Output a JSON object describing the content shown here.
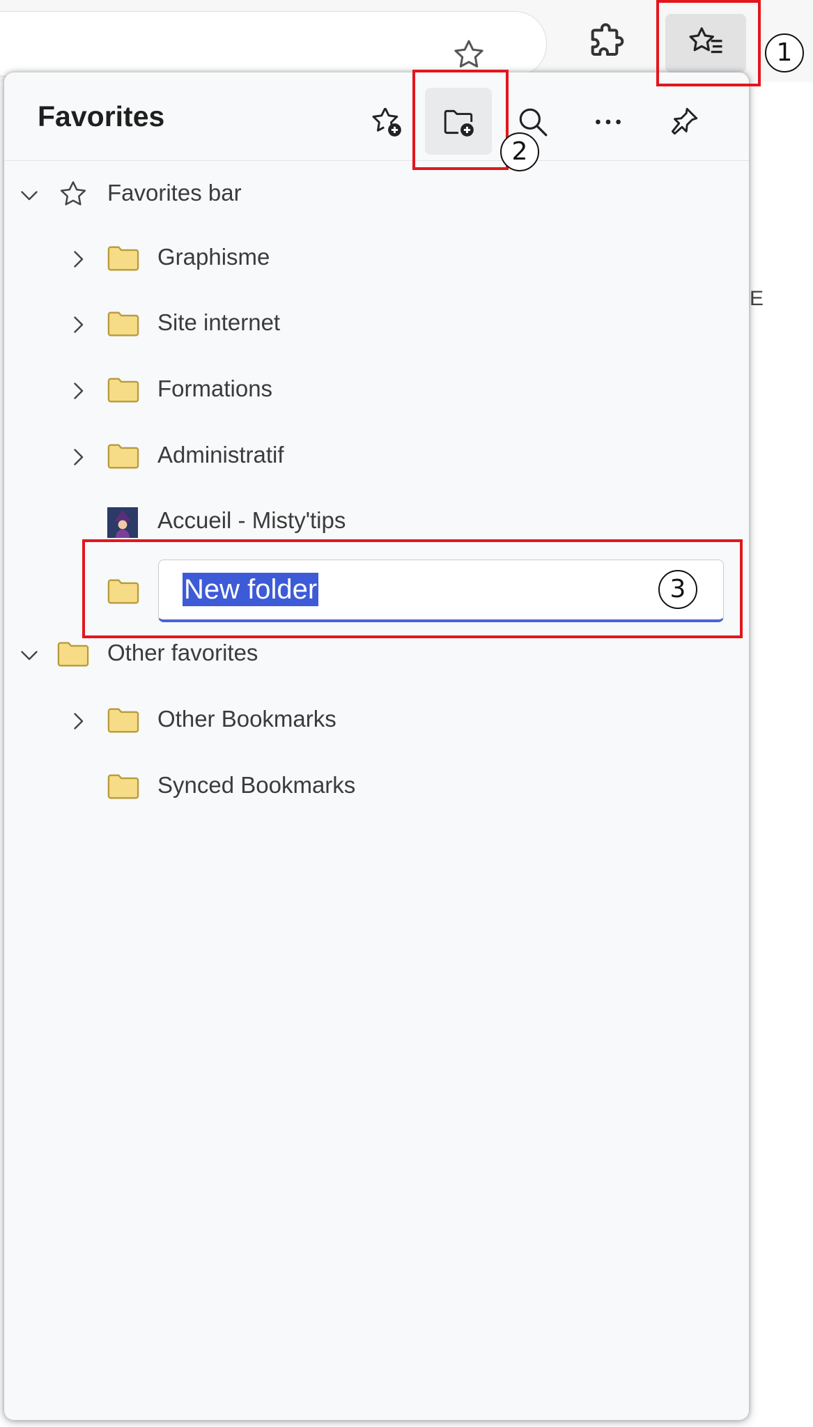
{
  "panel": {
    "title": "Favorites",
    "header_buttons": [
      {
        "name": "add-favorite",
        "icon": "star-plus-icon"
      },
      {
        "name": "add-folder",
        "icon": "folder-plus-icon"
      },
      {
        "name": "search",
        "icon": "search-icon"
      },
      {
        "name": "more",
        "icon": "more-horizontal-icon"
      },
      {
        "name": "pin",
        "icon": "pin-icon"
      }
    ]
  },
  "tree": {
    "favorites_bar": {
      "label": "Favorites bar",
      "children": [
        {
          "label": "Graphisme",
          "type": "folder",
          "expandable": true
        },
        {
          "label": "Site internet",
          "type": "folder",
          "expandable": true
        },
        {
          "label": "Formations",
          "type": "folder",
          "expandable": true
        },
        {
          "label": "Administratif",
          "type": "folder",
          "expandable": true
        },
        {
          "label": "Accueil - Misty'tips",
          "type": "page",
          "expandable": false
        }
      ],
      "new_folder_value": "New folder"
    },
    "other_favorites": {
      "label": "Other favorites",
      "children": [
        {
          "label": "Other Bookmarks",
          "type": "folder",
          "expandable": true
        },
        {
          "label": "Synced Bookmarks",
          "type": "folder",
          "expandable": false
        }
      ]
    }
  },
  "annotations": [
    "1",
    "2",
    "3"
  ],
  "page_fragment": "E",
  "colors": {
    "callout": "#e3161d",
    "selection": "#3d5bd6",
    "folder_fill": "#f6dc86",
    "folder_stroke": "#b89a3c"
  }
}
